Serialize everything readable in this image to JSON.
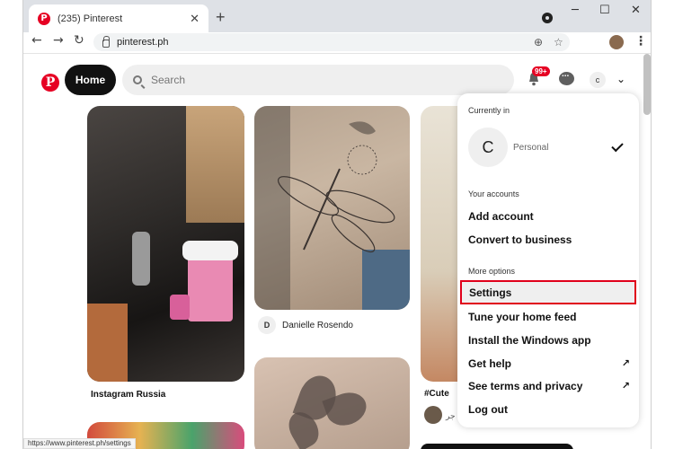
{
  "browser": {
    "tab_title": "(235) Pinterest",
    "tab_favicon_letter": "P",
    "close_glyph": "✕",
    "new_tab_glyph": "+",
    "minimize_glyph": "─",
    "maximize_glyph": "☐",
    "window_close_glyph": "✕",
    "back_glyph": "←",
    "forward_glyph": "→",
    "reload_glyph": "↻",
    "url": "pinterest.ph",
    "install_glyph": "⊕",
    "star_glyph": "☆",
    "menu_glyph": "⋮",
    "status_url": "https://www.pinterest.ph/settings"
  },
  "header": {
    "logo_letter": "P",
    "home_label": "Home",
    "search_placeholder": "Search",
    "notification_badge": "99+",
    "avatar_letter": "c",
    "chevron_glyph": "⌄"
  },
  "pins": {
    "car_caption": "Instagram Russia",
    "tattoo_author_initial": "D",
    "tattoo_author_name": "Danielle Rosendo",
    "right_caption": "#Cute",
    "right_author_text": "جر"
  },
  "menu": {
    "currently_in_label": "Currently in",
    "account_letter": "C",
    "account_type": "Personal",
    "your_accounts_label": "Your accounts",
    "add_account": "Add account",
    "convert_business": "Convert to business",
    "more_options_label": "More options",
    "settings": "Settings",
    "tune_feed": "Tune your home feed",
    "install_app": "Install the Windows app",
    "get_help": "Get help",
    "terms_privacy": "See terms and privacy",
    "log_out": "Log out",
    "external_glyph": "↗"
  },
  "colors": {
    "brand_red": "#e60023",
    "highlight_border": "#e0001b"
  }
}
